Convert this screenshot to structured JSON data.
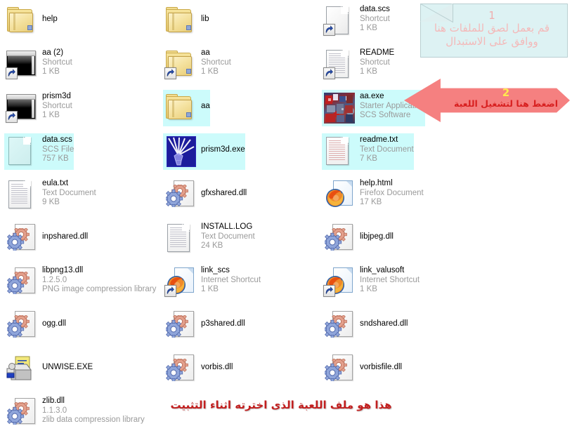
{
  "window": {
    "background_color": "#ffffff",
    "selection_color": "#ccfbfb"
  },
  "columns": [
    {
      "items": [
        {
          "name": "help",
          "meta1": "",
          "meta2": "",
          "icon": "folder-icon",
          "selected": false,
          "shortcut": false
        },
        {
          "name": "aa (2)",
          "meta1": "Shortcut",
          "meta2": "1 KB",
          "icon": "console-window-icon",
          "selected": false,
          "shortcut": true
        },
        {
          "name": "prism3d",
          "meta1": "Shortcut",
          "meta2": "1 KB",
          "icon": "console-window-icon",
          "selected": false,
          "shortcut": true
        },
        {
          "name": "data.scs",
          "meta1": "SCS File",
          "meta2": "757 KB",
          "icon": "scs-file-icon",
          "selected": true,
          "shortcut": false
        },
        {
          "name": "eula.txt",
          "meta1": "Text Document",
          "meta2": "9 KB",
          "icon": "text-document-icon",
          "selected": false,
          "shortcut": false
        },
        {
          "name": "inpshared.dll",
          "meta1": "",
          "meta2": "",
          "icon": "dll-gear-icon",
          "selected": false,
          "shortcut": false
        },
        {
          "name": "libpng13.dll",
          "meta1": "1.2.5.0",
          "meta2": "PNG image compression library",
          "icon": "dll-gear-icon",
          "selected": false,
          "shortcut": false
        },
        {
          "name": "ogg.dll",
          "meta1": "",
          "meta2": "",
          "icon": "dll-gear-icon",
          "selected": false,
          "shortcut": false
        },
        {
          "name": "UNWISE.EXE",
          "meta1": "",
          "meta2": "",
          "icon": "uninstaller-icon",
          "selected": false,
          "shortcut": false
        },
        {
          "name": "zlib.dll",
          "meta1": "1.1.3.0",
          "meta2": "zlib data compression library",
          "icon": "dll-gear-icon",
          "selected": false,
          "shortcut": false
        }
      ]
    },
    {
      "items": [
        {
          "name": "lib",
          "meta1": "",
          "meta2": "",
          "icon": "folder-icon",
          "selected": false,
          "shortcut": false
        },
        {
          "name": "aa",
          "meta1": "Shortcut",
          "meta2": "1 KB",
          "icon": "folder-icon",
          "selected": false,
          "shortcut": true
        },
        {
          "name": "aa",
          "meta1": "",
          "meta2": "",
          "icon": "folder-icon",
          "selected": true,
          "shortcut": false
        },
        {
          "name": "prism3d.exe",
          "meta1": "",
          "meta2": "",
          "icon": "prism3d-app-icon",
          "selected": true,
          "shortcut": false
        },
        {
          "name": "gfxshared.dll",
          "meta1": "",
          "meta2": "",
          "icon": "dll-gear-icon",
          "selected": false,
          "shortcut": false
        },
        {
          "name": "INSTALL.LOG",
          "meta1": "Text Document",
          "meta2": "24 KB",
          "icon": "text-document-icon",
          "selected": false,
          "shortcut": false
        },
        {
          "name": "link_scs",
          "meta1": "Internet Shortcut",
          "meta2": "1 KB",
          "icon": "firefox-document-icon",
          "selected": false,
          "shortcut": true
        },
        {
          "name": "p3shared.dll",
          "meta1": "",
          "meta2": "",
          "icon": "dll-gear-icon",
          "selected": false,
          "shortcut": false
        },
        {
          "name": "vorbis.dll",
          "meta1": "",
          "meta2": "",
          "icon": "dll-gear-icon",
          "selected": false,
          "shortcut": false
        }
      ]
    },
    {
      "items": [
        {
          "name": "data.scs",
          "meta1": "Shortcut",
          "meta2": "1 KB",
          "icon": "blank-document-icon",
          "selected": false,
          "shortcut": true
        },
        {
          "name": "README",
          "meta1": "Shortcut",
          "meta2": "1 KB",
          "icon": "text-document-icon",
          "selected": false,
          "shortcut": true
        },
        {
          "name": "aa.exe",
          "meta1": "Starter Application",
          "meta2": "SCS Software",
          "icon": "aa-application-icon",
          "selected": true,
          "shortcut": false
        },
        {
          "name": "readme.txt",
          "meta1": "Text Document",
          "meta2": "7 KB",
          "icon": "pink-text-document-icon",
          "selected": true,
          "shortcut": false
        },
        {
          "name": "help.html",
          "meta1": "Firefox Document",
          "meta2": "17 KB",
          "icon": "firefox-document-icon",
          "selected": false,
          "shortcut": false
        },
        {
          "name": "libjpeg.dll",
          "meta1": "",
          "meta2": "",
          "icon": "dll-gear-icon",
          "selected": false,
          "shortcut": false
        },
        {
          "name": "link_valusoft",
          "meta1": "Internet Shortcut",
          "meta2": "1 KB",
          "icon": "firefox-document-icon",
          "selected": false,
          "shortcut": true
        },
        {
          "name": "sndshared.dll",
          "meta1": "",
          "meta2": "",
          "icon": "dll-gear-icon",
          "selected": false,
          "shortcut": false
        },
        {
          "name": "vorbisfile.dll",
          "meta1": "",
          "meta2": "",
          "icon": "dll-gear-icon",
          "selected": false,
          "shortcut": false
        }
      ]
    }
  ],
  "callout": {
    "number": "1",
    "line1": "قم بعمل لصق للملفات هنا",
    "line2": "ووافق على الاستبدال",
    "bg_color": "#ddf2f3",
    "text_color": "#f4b9b9"
  },
  "arrow": {
    "number": "2",
    "text": "اضغط هنا لتشغيل اللعبة",
    "fill_color": "#f58080",
    "number_color": "#ffe94d",
    "text_color": "#d82020"
  },
  "caption": {
    "text": "هذا هو ملف اللعبة الذى اخترته اثناء التثبيت",
    "color": "#c21f1f"
  }
}
